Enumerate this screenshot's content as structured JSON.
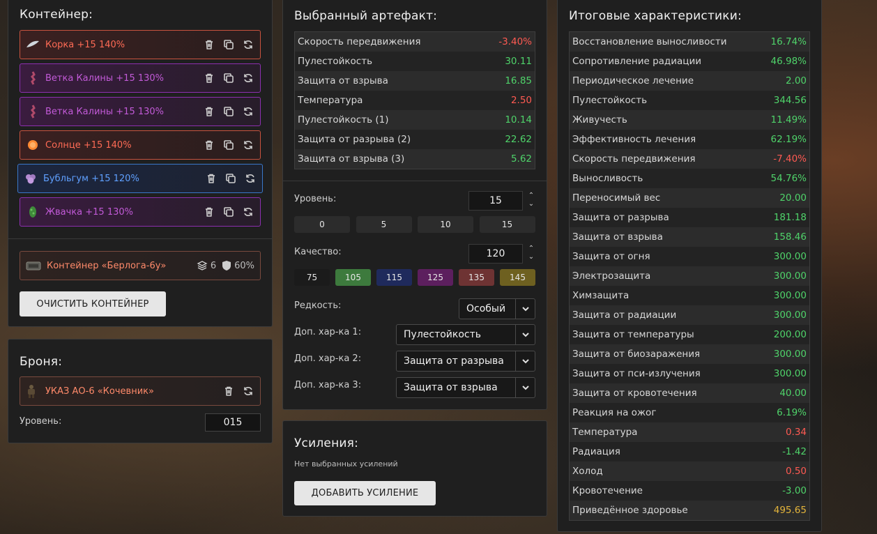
{
  "container": {
    "title": "Контейнер:",
    "artifacts": [
      {
        "name": "Корка +15 140%",
        "color": "red",
        "icon": "blade-icon"
      },
      {
        "name": "Ветка Калины +15 130%",
        "color": "purple",
        "icon": "branch-icon"
      },
      {
        "name": "Ветка Калины +15 130%",
        "color": "purple",
        "icon": "branch-icon"
      },
      {
        "name": "Солнце +15 140%",
        "color": "red",
        "icon": "sun-icon"
      },
      {
        "name": "Бубльгум +15 120%",
        "color": "blue",
        "icon": "bubblegum-icon"
      },
      {
        "name": "Жвачка +15 130%",
        "color": "purple",
        "icon": "gum-icon"
      }
    ],
    "container_item": {
      "name": "Контейнер «Берлога-6у»",
      "slots": "6",
      "protection": "60%"
    },
    "clear_button": "ОЧИСТИТЬ КОНТЕЙНЕР"
  },
  "armor": {
    "title": "Броня:",
    "item": "УКАЗ АО-6 «Кочевник»",
    "level_label": "Уровень:",
    "level_value": "015"
  },
  "artifact": {
    "title": "Выбранный артефакт:",
    "stats": [
      {
        "label": "Скорость передвижения",
        "value": "-3.40%",
        "tone": "red"
      },
      {
        "label": "Пулестойкость",
        "value": "30.11",
        "tone": "green"
      },
      {
        "label": "Защита от взрыва",
        "value": "16.85",
        "tone": "green"
      },
      {
        "label": "Температура",
        "value": "2.50",
        "tone": "red"
      },
      {
        "label": "Пулестойкость (1)",
        "value": "10.14",
        "tone": "green"
      },
      {
        "label": "Защита от разрыва (2)",
        "value": "22.62",
        "tone": "green"
      },
      {
        "label": "Защита от взрыва (3)",
        "value": "5.62",
        "tone": "green"
      }
    ],
    "level_label": "Уровень:",
    "level_value": "15",
    "level_presets": [
      "0",
      "5",
      "10",
      "15"
    ],
    "quality_label": "Качество:",
    "quality_value": "120",
    "quality_presets": [
      {
        "label": "75",
        "color": "#1b1b1b"
      },
      {
        "label": "105",
        "color": "#3d7a3d"
      },
      {
        "label": "115",
        "color": "#1f2a5c"
      },
      {
        "label": "125",
        "color": "#5c1f5e"
      },
      {
        "label": "135",
        "color": "#6e3333"
      },
      {
        "label": "145",
        "color": "#6e6020"
      }
    ],
    "rarity_label": "Редкость:",
    "rarity_value": "Особый",
    "extra1_label": "Доп. хар-ка 1:",
    "extra1_value": "Пулестойкость",
    "extra2_label": "Доп. хар-ка 2:",
    "extra2_value": "Защита от разрыва",
    "extra3_label": "Доп. хар-ка 3:",
    "extra3_value": "Защита от взрыва"
  },
  "boosts": {
    "title": "Усиления:",
    "empty_text": "Нет выбранных усилений",
    "add_button": "ДОБАВИТЬ УСИЛЕНИЕ"
  },
  "totals": {
    "title": "Итоговые характеристики:",
    "stats": [
      {
        "label": "Восстановление выносливости",
        "value": "16.74%",
        "tone": "green"
      },
      {
        "label": "Сопротивление радиации",
        "value": "46.98%",
        "tone": "green"
      },
      {
        "label": "Периодическое лечение",
        "value": "2.00",
        "tone": "green"
      },
      {
        "label": "Пулестойкость",
        "value": "344.56",
        "tone": "green"
      },
      {
        "label": "Живучесть",
        "value": "11.49%",
        "tone": "green"
      },
      {
        "label": "Эффективность лечения",
        "value": "62.19%",
        "tone": "green"
      },
      {
        "label": "Скорость передвижения",
        "value": "-7.40%",
        "tone": "red"
      },
      {
        "label": "Выносливость",
        "value": "54.76%",
        "tone": "green"
      },
      {
        "label": "Переносимый вес",
        "value": "20.00",
        "tone": "green"
      },
      {
        "label": "Защита от разрыва",
        "value": "181.18",
        "tone": "green"
      },
      {
        "label": "Защита от взрыва",
        "value": "158.46",
        "tone": "green"
      },
      {
        "label": "Защита от огня",
        "value": "300.00",
        "tone": "green"
      },
      {
        "label": "Электрозащита",
        "value": "300.00",
        "tone": "green"
      },
      {
        "label": "Химзащита",
        "value": "300.00",
        "tone": "green"
      },
      {
        "label": "Защита от радиации",
        "value": "300.00",
        "tone": "green"
      },
      {
        "label": "Защита от температуры",
        "value": "200.00",
        "tone": "green"
      },
      {
        "label": "Защита от биозаражения",
        "value": "300.00",
        "tone": "green"
      },
      {
        "label": "Защита от пси-излучения",
        "value": "300.00",
        "tone": "green"
      },
      {
        "label": "Защита от кровотечения",
        "value": "40.00",
        "tone": "green"
      },
      {
        "label": "Реакция на ожог",
        "value": "6.19%",
        "tone": "green"
      },
      {
        "label": "Температура",
        "value": "0.34",
        "tone": "red"
      },
      {
        "label": "Радиация",
        "value": "-1.42",
        "tone": "green"
      },
      {
        "label": "Холод",
        "value": "0.50",
        "tone": "red"
      },
      {
        "label": "Кровотечение",
        "value": "-3.00",
        "tone": "green"
      },
      {
        "label": "Приведённое здоровье",
        "value": "495.65",
        "tone": "gold"
      }
    ]
  }
}
